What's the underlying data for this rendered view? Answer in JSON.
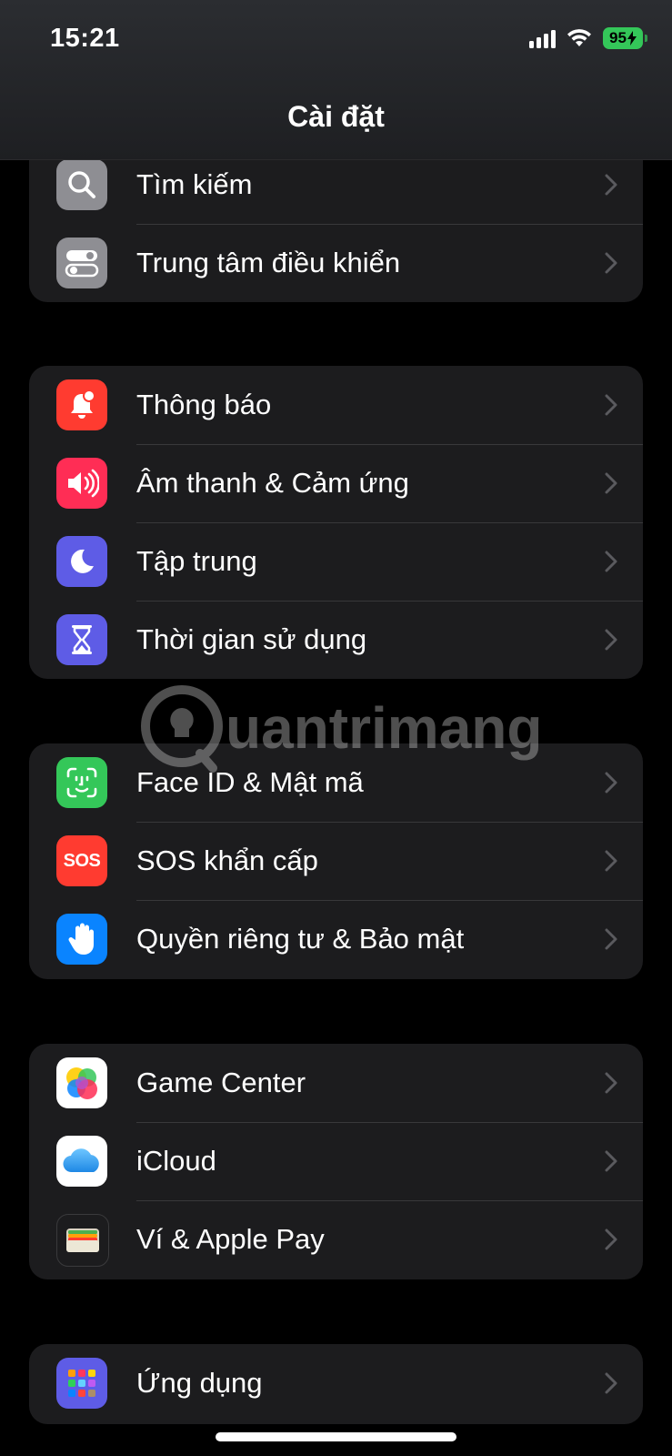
{
  "status_bar": {
    "time": "15:21",
    "battery": "95"
  },
  "header": {
    "title": "Cài đặt"
  },
  "groups": [
    {
      "items": [
        {
          "label": "Tìm kiếm",
          "icon": "search-icon",
          "color": "#8e8e93"
        },
        {
          "label": "Trung tâm điều khiển",
          "icon": "control-center-icon",
          "color": "#8e8e93"
        }
      ]
    },
    {
      "items": [
        {
          "label": "Thông báo",
          "icon": "notification-bell-icon",
          "color": "#ff3b30"
        },
        {
          "label": "Âm thanh & Cảm ứng",
          "icon": "speaker-icon",
          "color": "#ff2d55"
        },
        {
          "label": "Tập trung",
          "icon": "moon-icon",
          "color": "#5e5ce6"
        },
        {
          "label": "Thời gian sử dụng",
          "icon": "hourglass-icon",
          "color": "#5e5ce6"
        }
      ]
    },
    {
      "items": [
        {
          "label": "Face ID & Mật mã",
          "icon": "face-id-icon",
          "color": "#34c759"
        },
        {
          "label": "SOS khẩn cấp",
          "icon": "sos-icon",
          "color": "#ff3b30",
          "badge": "SOS"
        },
        {
          "label": "Quyền riêng tư & Bảo mật",
          "icon": "hand-icon",
          "color": "#0a84ff"
        }
      ]
    },
    {
      "items": [
        {
          "label": "Game Center",
          "icon": "game-center-icon",
          "color": "#ffffff"
        },
        {
          "label": "iCloud",
          "icon": "icloud-icon",
          "color": "#ffffff"
        },
        {
          "label": "Ví & Apple Pay",
          "icon": "wallet-icon",
          "color": "#1c1c1e"
        }
      ]
    },
    {
      "items": [
        {
          "label": "Ứng dụng",
          "icon": "apps-grid-icon",
          "color": "#5e5ce6"
        }
      ]
    }
  ],
  "watermark": "uantrimang"
}
